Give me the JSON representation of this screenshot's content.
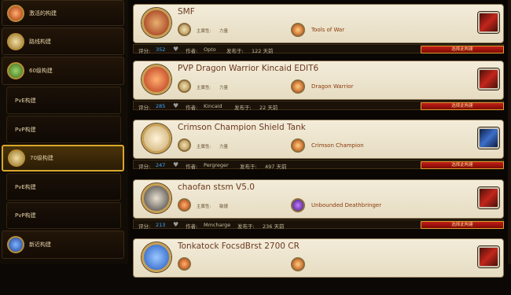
{
  "sidebar": {
    "items": [
      {
        "label": "激活的构建",
        "icon": "swords-icon",
        "tone": "red"
      },
      {
        "label": "路线构建",
        "icon": "tree-icon",
        "tone": "tan"
      },
      {
        "label": "60级构建",
        "icon": "level-60-icon",
        "tone": "green"
      },
      {
        "label": "PvE构建"
      },
      {
        "label": "PvP构建"
      },
      {
        "label": "70级构建",
        "icon": "level-70-icon",
        "tone": "tan"
      },
      {
        "label": "PvE构建"
      },
      {
        "label": "PvP构建"
      },
      {
        "label": "新近构建",
        "icon": "blue-rune-icon",
        "tone": "blue"
      }
    ]
  },
  "labels": {
    "score": "评分:",
    "author": "作者:",
    "published": "发布于:",
    "stat": "主属性:",
    "select_button": "选择此构建"
  },
  "builds": [
    {
      "title": "SMF",
      "stat": "力量",
      "artifact": "Tools of War",
      "score": "352",
      "author": "Opto",
      "age": "122 天前",
      "spec_color": "#9b2a12",
      "class_color": "#c2261c"
    },
    {
      "title": "PVP Dragon Warrior Kincaid EDIT6",
      "stat": "力量",
      "artifact": "Dragon Warrior",
      "score": "285",
      "author": "Kincaid",
      "age": "22 天前",
      "spec_color": "#b8321a",
      "class_color": "#c2261c"
    },
    {
      "title": "Crimson Champion Shield Tank",
      "stat": "力量",
      "artifact": "Crimson Champion",
      "score": "247",
      "author": "Pergreger",
      "age": "497 天前",
      "spec_color": "#d7c79b",
      "class_color": "#3d6fc9"
    },
    {
      "title": "chaofan stsm V5.0",
      "stat": "敏捷",
      "artifact": "Unbounded Deathbringer",
      "score": "213",
      "author": "Mmcharge",
      "age": "236 天前",
      "spec_color": "#3d3a3a",
      "class_color": "#c2261c"
    },
    {
      "title": "Tonkatock FocsdBrst 2700 CR",
      "stat": "",
      "artifact": "",
      "score": "",
      "author": "",
      "age": "",
      "spec_color": "#1f57c0",
      "class_color": "#c2261c"
    }
  ],
  "colors": {
    "accent": "#d8a82a",
    "button": "#c41d16",
    "score": "#3fa6ff"
  }
}
